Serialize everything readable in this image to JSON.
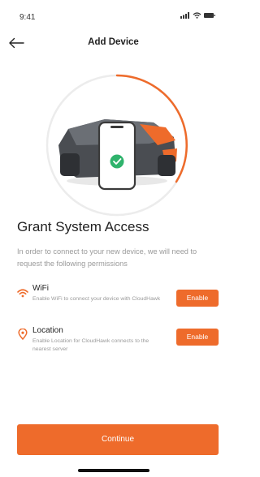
{
  "status_bar": {
    "time": "9:41"
  },
  "header": {
    "title": "Add Device"
  },
  "hero": {
    "progress": 0.32,
    "accent_color": "#ee6b2b",
    "icon": "mower-phone-check-illustration"
  },
  "section": {
    "title": "Grant System Access",
    "description": "In order to connect to your new device, we will need to request the following permissions"
  },
  "permissions": [
    {
      "icon": "wifi-icon",
      "title": "WiFi",
      "description": "Enable WiFi to connect your device with CloudHawk",
      "button_label": "Enable"
    },
    {
      "icon": "location-pin-icon",
      "title": "Location",
      "description": "Enable Location for CloudHawk connects to the nearest server",
      "button_label": "Enable"
    }
  ],
  "footer": {
    "continue_label": "Continue"
  },
  "colors": {
    "accent": "#ee6b2b",
    "muted_text": "#9a9a9a"
  }
}
